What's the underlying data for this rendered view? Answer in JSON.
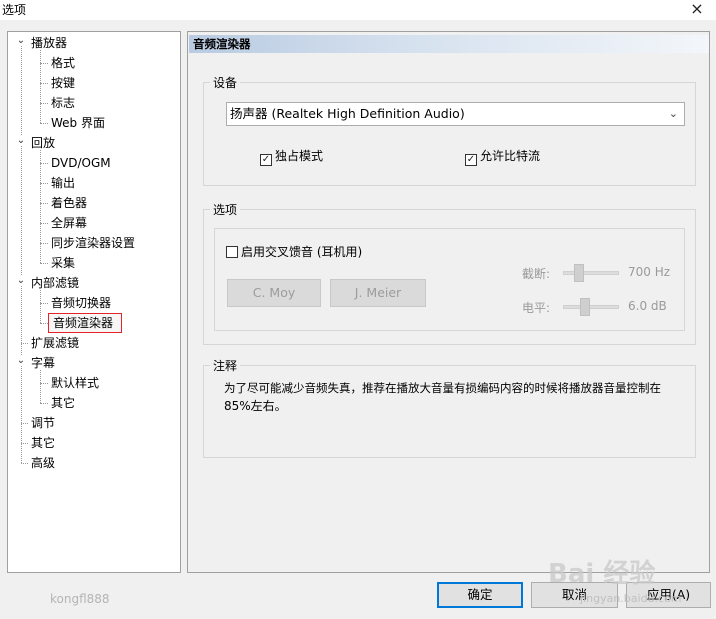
{
  "window": {
    "title": "选项",
    "close_glyph": "×"
  },
  "tree": {
    "items": [
      {
        "label": "播放器",
        "level": 0,
        "expanded": true
      },
      {
        "label": "格式",
        "level": 1
      },
      {
        "label": "按键",
        "level": 1
      },
      {
        "label": "标志",
        "level": 1
      },
      {
        "label": "Web 界面",
        "level": 1
      },
      {
        "label": "回放",
        "level": 0,
        "expanded": true
      },
      {
        "label": "DVD/OGM",
        "level": 1
      },
      {
        "label": "输出",
        "level": 1
      },
      {
        "label": "着色器",
        "level": 1
      },
      {
        "label": "全屏幕",
        "level": 1
      },
      {
        "label": "同步渲染器设置",
        "level": 1
      },
      {
        "label": "采集",
        "level": 1
      },
      {
        "label": "内部滤镜",
        "level": 0,
        "expanded": true
      },
      {
        "label": "音频切换器",
        "level": 1
      },
      {
        "label": "音频渲染器",
        "level": 1,
        "selected": true
      },
      {
        "label": "扩展滤镜",
        "level": 0
      },
      {
        "label": "字幕",
        "level": 0,
        "expanded": true
      },
      {
        "label": "默认样式",
        "level": 1
      },
      {
        "label": "其它",
        "level": 1
      },
      {
        "label": "调节",
        "level": 0
      },
      {
        "label": "其它",
        "level": 0
      },
      {
        "label": "高级",
        "level": 0
      }
    ],
    "toggle_glyph": "⌄"
  },
  "panel": {
    "header": "音频渲染器",
    "device": {
      "label": "设备",
      "select_value": "扬声器 (Realtek High Definition Audio)",
      "exclusive_label": "独占模式",
      "exclusive_checked": true,
      "bitstream_label": "允许比特流",
      "bitstream_checked": true
    },
    "options": {
      "label": "选项",
      "crossfeed_label": "启用交叉馈音 (耳机用)",
      "crossfeed_checked": false,
      "btn_cmoy": "C. Moy",
      "btn_jmeier": "J. Meier",
      "cutoff_label": "截断:",
      "cutoff_value": "700 Hz",
      "level_label": "电平:",
      "level_value": "6.0 dB"
    },
    "note": {
      "label": "注释",
      "text_line1": "为了尽可能减少音频失真，推荐在播放大音量有损编码内容的时候将播放器音量控制在",
      "text_line2": "85%左右。"
    }
  },
  "footer": {
    "ok": "确定",
    "cancel": "取消",
    "apply": "应用(A)",
    "watermark_user": "kongfl888",
    "watermark_brand": "Bai 经验",
    "watermark_url": "jingyan.baidu.com"
  },
  "colors": {
    "selection_outline": "#e3242b",
    "accent": "#0078d7"
  }
}
